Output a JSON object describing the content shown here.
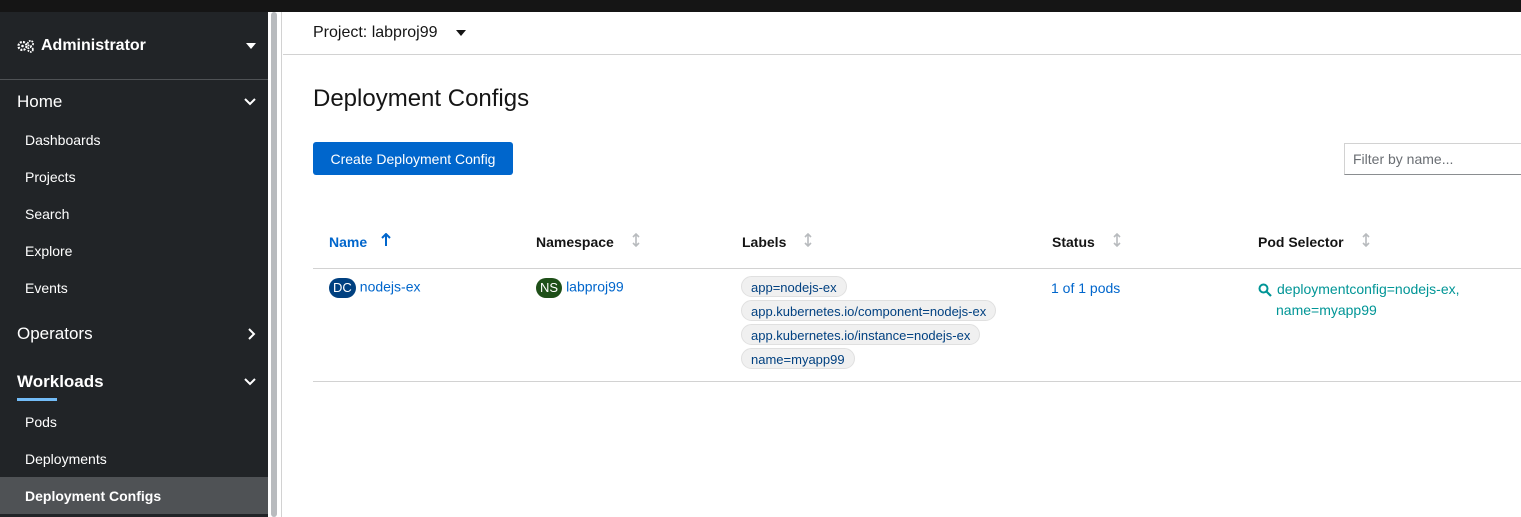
{
  "sidebar": {
    "perspective": "Administrator",
    "sections": {
      "home": {
        "label": "Home",
        "items": [
          "Dashboards",
          "Projects",
          "Search",
          "Explore",
          "Events"
        ]
      },
      "operators": {
        "label": "Operators"
      },
      "workloads": {
        "label": "Workloads",
        "items": [
          "Pods",
          "Deployments",
          "Deployment Configs"
        ],
        "active": "Deployment Configs"
      }
    }
  },
  "project_bar": {
    "label": "Project: labproj99"
  },
  "page": {
    "title": "Deployment Configs",
    "create_button": "Create Deployment Config",
    "filter_placeholder": "Filter by name..."
  },
  "table": {
    "columns": [
      "Name",
      "Namespace",
      "Labels",
      "Status",
      "Pod Selector"
    ],
    "sorted_column": "Name",
    "rows": [
      {
        "name_badge": "DC",
        "name": "nodejs-ex",
        "namespace_badge": "NS",
        "namespace": "labproj99",
        "labels": [
          "app=nodejs-ex",
          "app.kubernetes.io/component=nodejs-ex",
          "app.kubernetes.io/instance=nodejs-ex",
          "name=myapp99"
        ],
        "status": "1 of 1 pods",
        "pod_selector_line1": "deploymentconfig=nodejs-ex,",
        "pod_selector_line2": "name=myapp99"
      }
    ]
  },
  "colors": {
    "accent": "#0066cc",
    "sidebar_bg": "#212427",
    "active_item_bg": "#4f5255",
    "teal": "#009596",
    "dc_badge": "#004080",
    "ns_badge": "#1e4f18"
  }
}
